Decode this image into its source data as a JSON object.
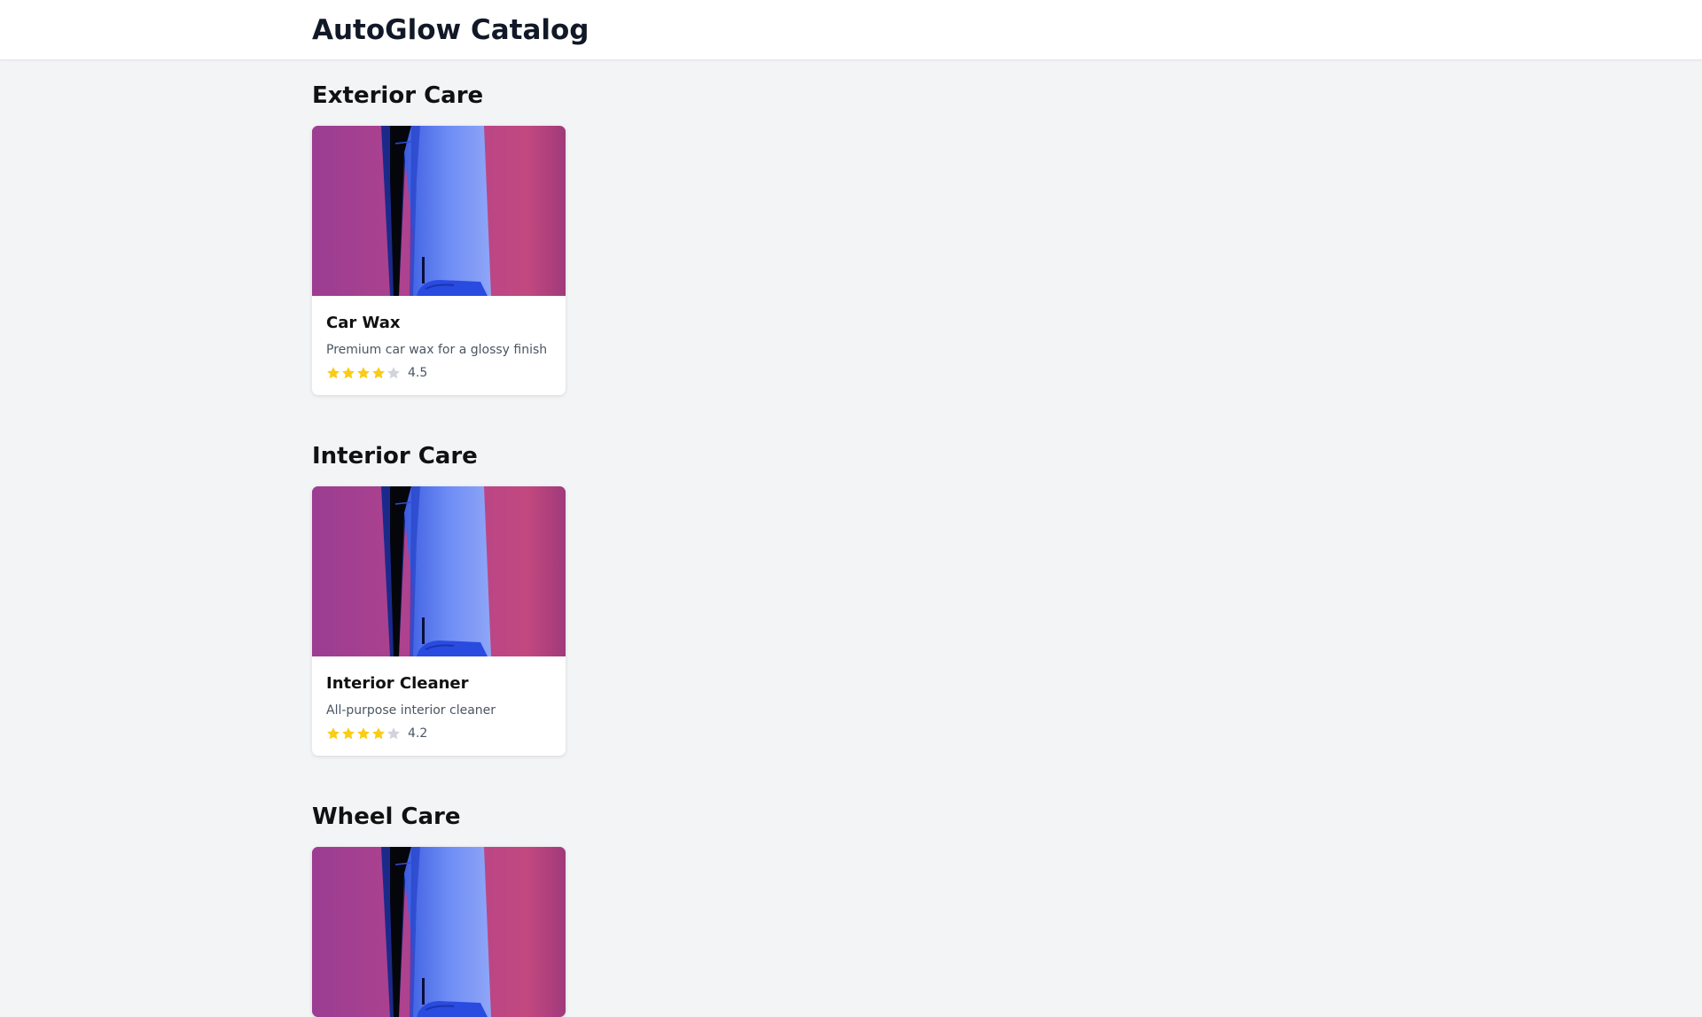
{
  "app": {
    "title": "AutoGlow Catalog"
  },
  "colors": {
    "star_filled": "#facc15",
    "star_empty": "#d1d5db",
    "image_bg": "#b3448a"
  },
  "categories": [
    {
      "title": "Exterior Care",
      "products": [
        {
          "name": "Car Wax",
          "description": "Premium car wax for a glossy finish",
          "rating": 4.5,
          "rating_label": "4.5",
          "image_icon": "product-photo"
        }
      ]
    },
    {
      "title": "Interior Care",
      "products": [
        {
          "name": "Interior Cleaner",
          "description": "All-purpose interior cleaner",
          "rating": 4.2,
          "rating_label": "4.2",
          "image_icon": "product-photo"
        }
      ]
    },
    {
      "title": "Wheel Care",
      "products": [
        {
          "name": "",
          "description": "",
          "rating": null,
          "rating_label": "",
          "image_icon": "product-photo"
        }
      ]
    }
  ]
}
